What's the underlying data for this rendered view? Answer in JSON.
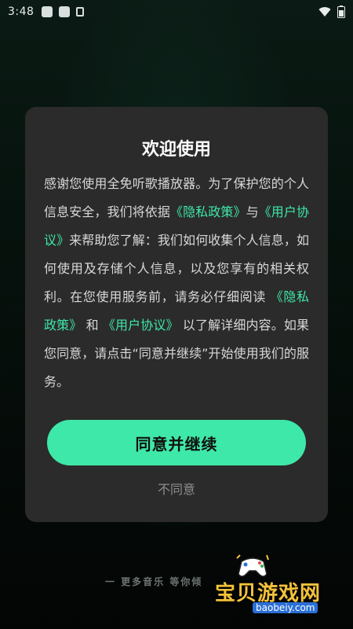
{
  "status_bar": {
    "time": "3:48"
  },
  "dialog": {
    "title": "欢迎使用",
    "body": {
      "t1": "感谢您使用全免听歌播放器。为了保护您的个人信息安全，我们将依据",
      "link_privacy": "《隐私政策》",
      "t2": "与",
      "link_user": "《用户协议》",
      "t3": "来帮助您了解：我们如何收集个人信息，如何使用及存储个人信息，以及您享有的相关权利。在您使用服务前，请务必仔细阅读 ",
      "t4": " 和 ",
      "t5": " 以了解详细内容。如果您同意，请点击“同意并继续”开始使用我们的服务。"
    },
    "agree_label": "同意并继续",
    "disagree_label": "不同意"
  },
  "footer": {
    "slogan": "一 更多音乐 等你倾"
  },
  "watermark": {
    "text": "宝贝游戏网",
    "domain": "baobeiy.com"
  },
  "colors": {
    "accent": "#3ee8a8",
    "dialog_bg": "#2b2b2b",
    "watermark_yellow": "#f4c23a"
  }
}
